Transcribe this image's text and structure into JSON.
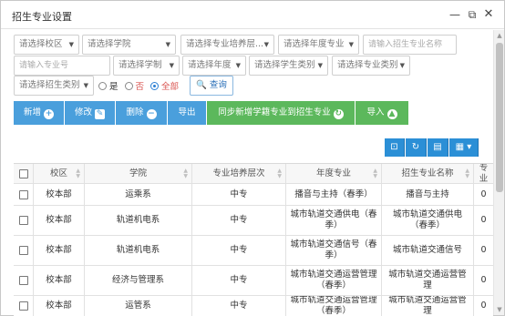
{
  "window": {
    "title": "招生专业设置",
    "min": "—",
    "max": "⧉",
    "close": "✕"
  },
  "filters": {
    "campus": "请选择校区",
    "college": "请选择学院",
    "level": "请选择专业培养层...",
    "year_major": "请选择年度专业",
    "enroll_major_name_ph": "请输入招生专业名称",
    "major_no_ph": "请输入专业号",
    "system": "请选择学制",
    "year": "请选择年度",
    "student_type": "请选择学生类别",
    "major_type": "请选择专业类别",
    "enroll_type": "请选择招生类别",
    "radio_yes": "是",
    "radio_no": "否",
    "radio_all": "全部",
    "radio_selected": "all",
    "query_label": "查询"
  },
  "toolbar": {
    "add": "新增",
    "edit": "修改",
    "delete": "删除",
    "export": "导出",
    "sync": "同步新增学籍专业到招生专业",
    "import": "导入"
  },
  "table_tools": [
    "⊡",
    "↻",
    "▤",
    "▦"
  ],
  "table": {
    "headers": [
      "校区",
      "学院",
      "专业培养层次",
      "年度专业",
      "招生专业名称",
      "专业"
    ],
    "rows": [
      [
        "校本部",
        "运乘系",
        "中专",
        "播音与主持（春季）",
        "播音与主持",
        "0"
      ],
      [
        "校本部",
        "轨道机电系",
        "中专",
        "城市轨道交通供电（春季）",
        "城市轨道交通供电（春季）",
        "0"
      ],
      [
        "校本部",
        "轨道机电系",
        "中专",
        "城市轨道交通信号（春季）",
        "城市轨道交通信号",
        "0"
      ],
      [
        "校本部",
        "经济与管理系",
        "中专",
        "城市轨道交通运营管理（春季）",
        "城市轨道交通运营管理",
        "0"
      ],
      [
        "校本部",
        "运管系",
        "中专",
        "城市轨道交通运营管理（春季）",
        "城市轨道交通运营管理",
        "0"
      ]
    ]
  },
  "colors": {
    "accent": "#2b8fd6",
    "button_blue": "#4a9fdc",
    "button_green": "#5cb85c",
    "radio_red": "#d9534f"
  }
}
